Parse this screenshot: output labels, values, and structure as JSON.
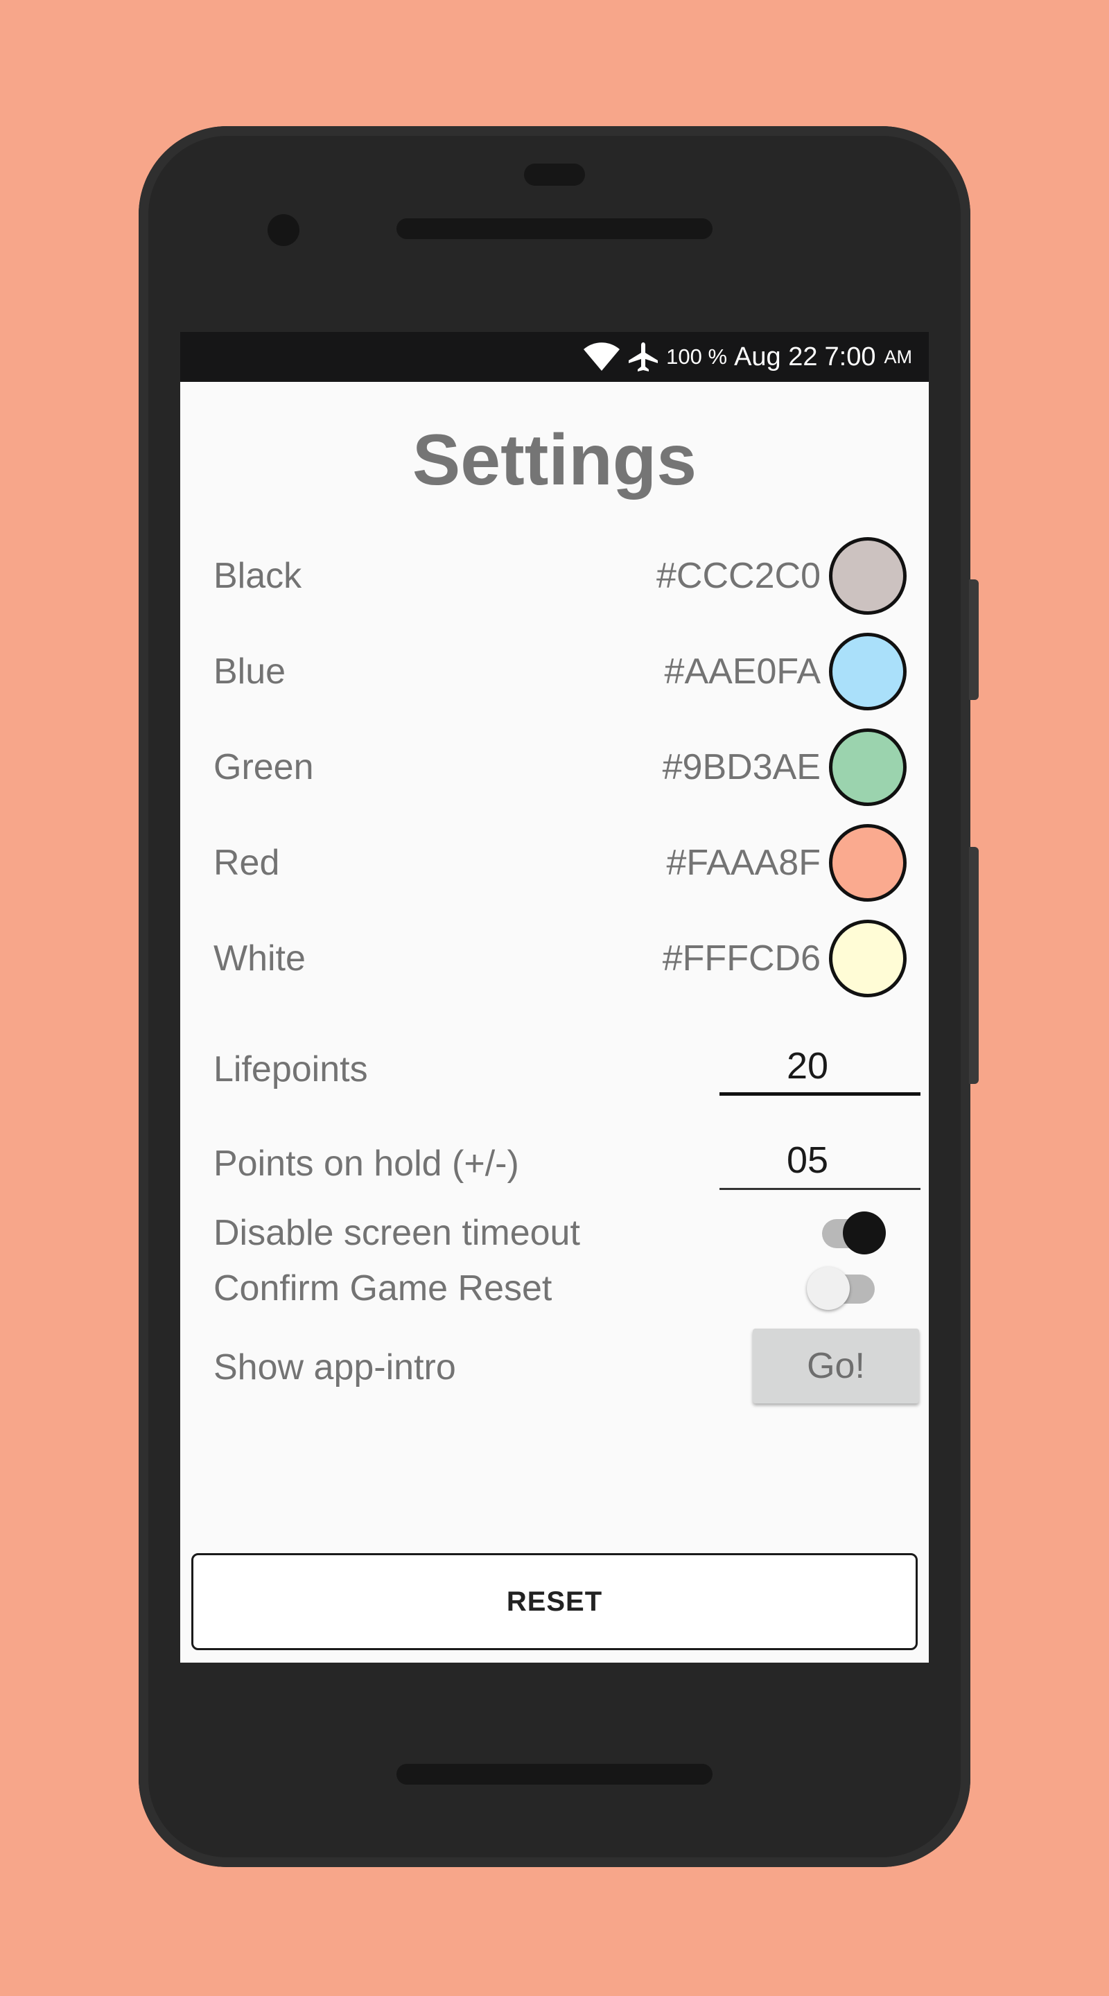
{
  "status_bar": {
    "battery": "100 %",
    "date": "Aug 22",
    "time": "7:00",
    "ampm": "AM"
  },
  "title": "Settings",
  "colors": [
    {
      "name": "Black",
      "hex": "#CCC2C0"
    },
    {
      "name": "Blue",
      "hex": "#AAE0FA"
    },
    {
      "name": "Green",
      "hex": "#9BD3AE"
    },
    {
      "name": "Red",
      "hex": "#FAAA8F"
    },
    {
      "name": "White",
      "hex": "#FFFCD6"
    }
  ],
  "lifepoints": {
    "label": "Lifepoints",
    "value": "20"
  },
  "points_on_hold": {
    "label": "Points on hold (+/-)",
    "value": "05"
  },
  "toggles": [
    {
      "label": "Disable screen timeout",
      "state": "on"
    },
    {
      "label": "Confirm Game Reset",
      "state": "off"
    }
  ],
  "app_intro": {
    "label": "Show app-intro",
    "button": "Go!"
  },
  "reset_button": "RESET",
  "theme": {
    "background": "#F7A68A",
    "phone_body": "#262626",
    "screen_bg": "#FAFAFA",
    "text_gray": "#737373"
  }
}
